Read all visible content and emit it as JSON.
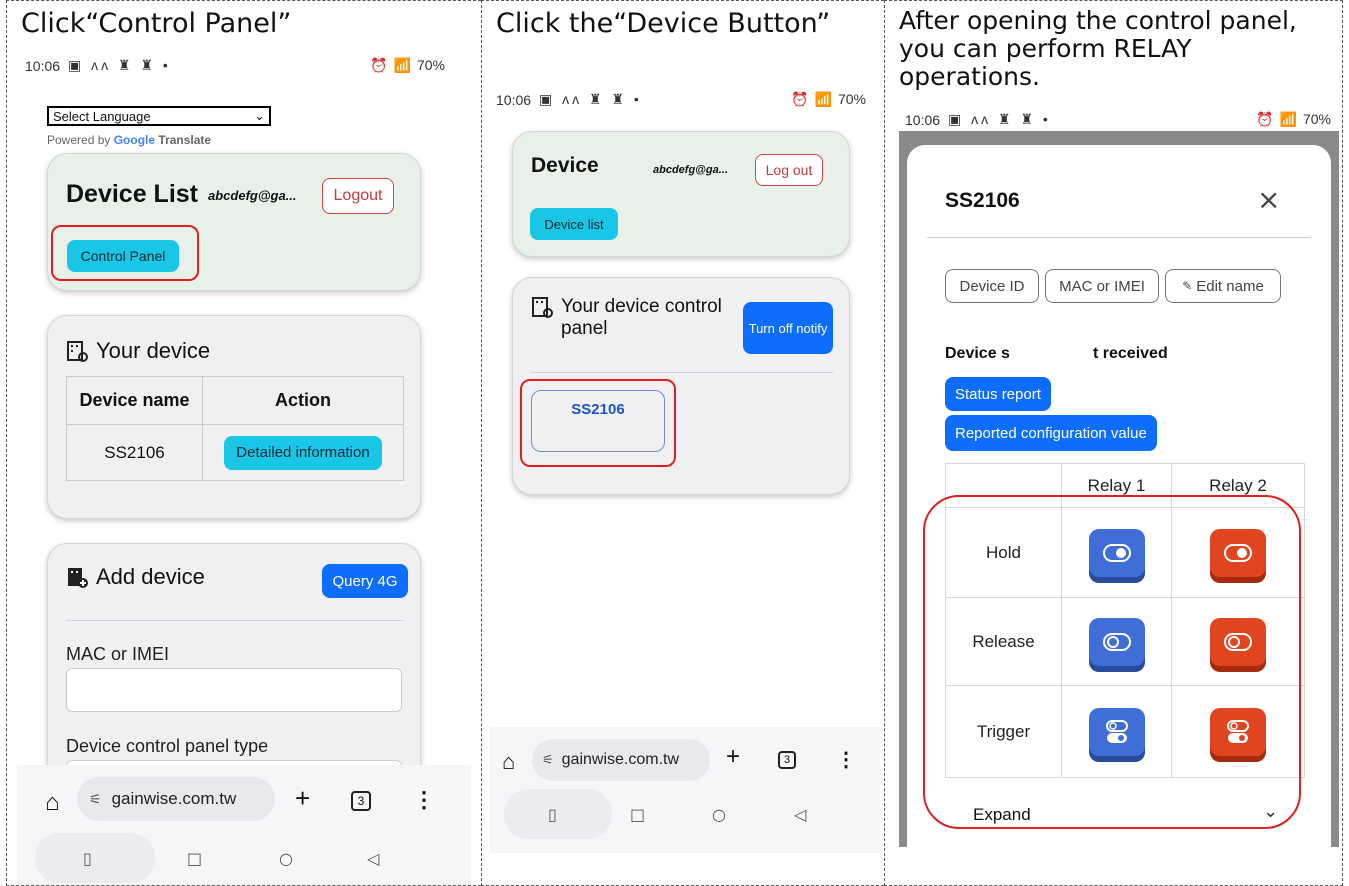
{
  "panel1": {
    "caption": "Click“Control Panel”",
    "status": {
      "time": "10:06",
      "icons": "▣ ʌʌ ♜ ♜ •",
      "battery": "70%"
    },
    "language": {
      "select": "Select Language",
      "powered_by": "Powered by",
      "google": "Google",
      "translate": "Translate"
    },
    "header": {
      "title": "Device List",
      "email": "abcdefg@ga...",
      "logout": "Logout",
      "control_panel": "Control Panel"
    },
    "your_device": {
      "title": "Your device",
      "col_name": "Device name",
      "col_action": "Action",
      "rows": [
        {
          "name": "SS2106",
          "action": "Detailed information"
        }
      ]
    },
    "add_device": {
      "title": "Add device",
      "query_btn": "Query 4G",
      "mac_label": "MAC or IMEI",
      "type_label": "Device control panel type"
    },
    "browser": {
      "url": "gainwise.com.tw",
      "tabs": "3"
    }
  },
  "panel2": {
    "caption": "Click the“Device Button”",
    "status": {
      "time": "10:06",
      "icons": "▣ ʌʌ ♜ ♜ •",
      "battery": "70%"
    },
    "header": {
      "title": "Device",
      "email": "abcdefg@ga...",
      "logout": "Log out",
      "device_list": "Device list"
    },
    "control": {
      "title": "Your device control panel",
      "notify_btn": "Turn off notify",
      "device": "SS2106"
    },
    "browser": {
      "url": "gainwise.com.tw",
      "tabs": "3"
    }
  },
  "panel3": {
    "caption": "After opening the control panel, you can perform RELAY operations.",
    "status": {
      "time": "10:06",
      "icons": "▣ ʌʌ ♜ ♜ •",
      "battery": "70%"
    },
    "modal": {
      "title": "SS2106",
      "pills": [
        "Device ID",
        "MAC or IMEI",
        "Edit name"
      ],
      "device_status": "Device s",
      "received": "t received",
      "status_report": "Status report",
      "reported_config": "Reported configuration value",
      "relays": [
        "Relay 1",
        "Relay 2"
      ],
      "rows": [
        "Hold",
        "Release",
        "Trigger"
      ],
      "expand": "Expand"
    }
  }
}
